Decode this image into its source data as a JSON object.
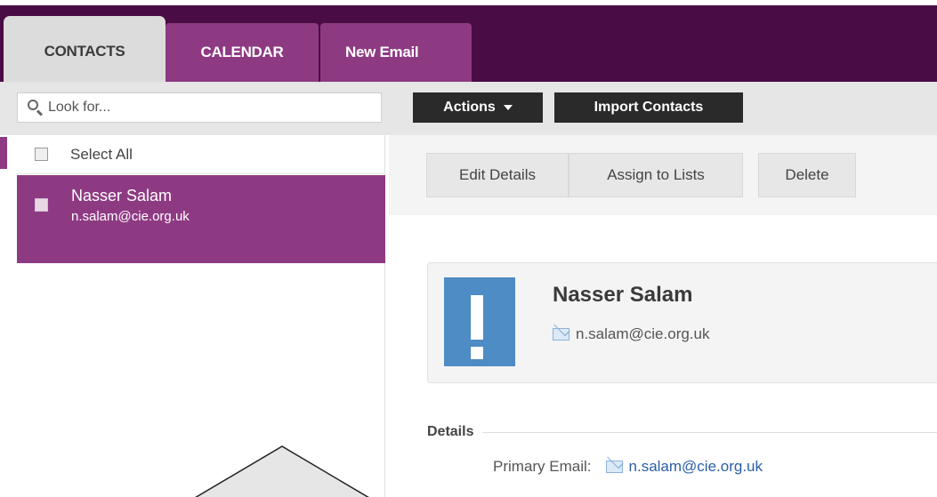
{
  "tabs": [
    {
      "label": "CONTACTS",
      "active": true
    },
    {
      "label": "CALENDAR",
      "active": false
    },
    {
      "label": "New Email",
      "active": false
    }
  ],
  "sidebar": {
    "search": {
      "placeholder": "Look for..."
    },
    "select_all_label": "Select All",
    "contacts": [
      {
        "name": "Nasser Salam",
        "email": "n.salam@cie.org.uk",
        "selected": true
      }
    ]
  },
  "toolbar": {
    "actions_label": "Actions",
    "import_label": "Import Contacts"
  },
  "contact_actions": {
    "edit_label": "Edit Details",
    "assign_label": "Assign to Lists",
    "delete_label": "Delete"
  },
  "contact_card": {
    "name": "Nasser Salam",
    "email": "n.salam@cie.org.uk"
  },
  "details": {
    "header": "Details",
    "primary_email_label": "Primary Email:",
    "primary_email_value": "n.salam@cie.org.uk"
  },
  "colors": {
    "brand_dark": "#4a0c44",
    "brand": "#8e3a83",
    "avatar": "#4d8cc4",
    "link": "#2a5fa6"
  }
}
